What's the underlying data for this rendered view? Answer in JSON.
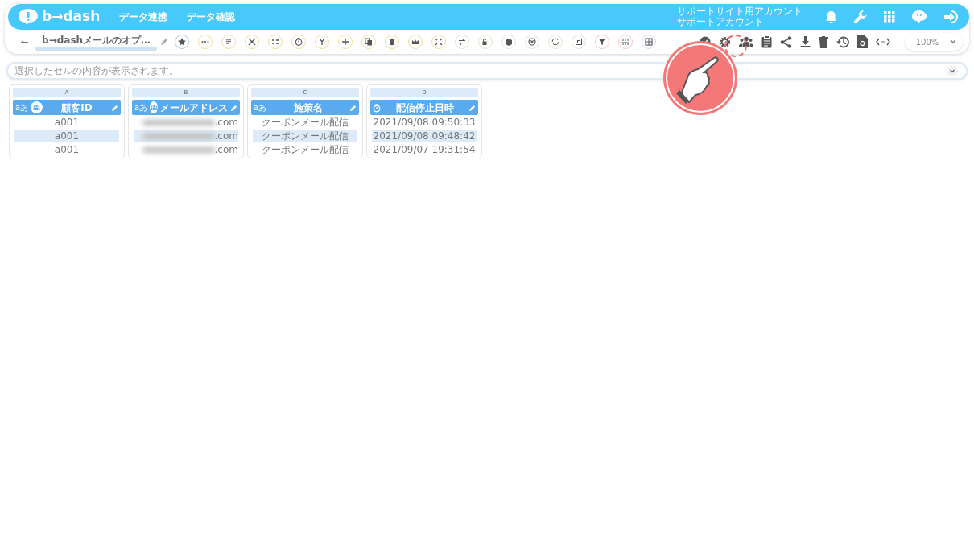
{
  "header": {
    "logo": "b→dash",
    "nav": [
      "データ連携",
      "データ確認"
    ],
    "account": [
      "サポートサイト用アカウント",
      "サポートアカウント"
    ]
  },
  "toolbar": {
    "back": "←",
    "title": "b→dashメールのオプ…",
    "zoom": "100%"
  },
  "cell_viewer": {
    "placeholder": "選択したセルの内容が表示されます。"
  },
  "columns": [
    {
      "letter": "A",
      "kind": "text-group",
      "type_mark": "aあ",
      "name": "顧客ID",
      "cells": [
        {
          "text": "a001"
        },
        {
          "text": "a001"
        },
        {
          "text": "a001"
        }
      ]
    },
    {
      "letter": "B",
      "kind": "text-group",
      "type_mark": "aあ",
      "name": "メールアドレス",
      "cells": [
        {
          "text": ".com",
          "redacted": true
        },
        {
          "text": ".com",
          "redacted": true
        },
        {
          "text": ".com",
          "redacted": true
        }
      ]
    },
    {
      "letter": "C",
      "kind": "text",
      "type_mark": "aあ",
      "name": "施策名",
      "cells": [
        {
          "text": "クーポンメール配信"
        },
        {
          "text": "クーポンメール配信"
        },
        {
          "text": "クーポンメール配信"
        }
      ]
    },
    {
      "letter": "D",
      "kind": "datetime",
      "name": "配信停止日時",
      "cells": [
        {
          "text": "2021/09/08 09:50:33"
        },
        {
          "text": "2021/09/08 09:48:42"
        },
        {
          "text": "2021/09/07 19:31:54"
        }
      ]
    }
  ]
}
